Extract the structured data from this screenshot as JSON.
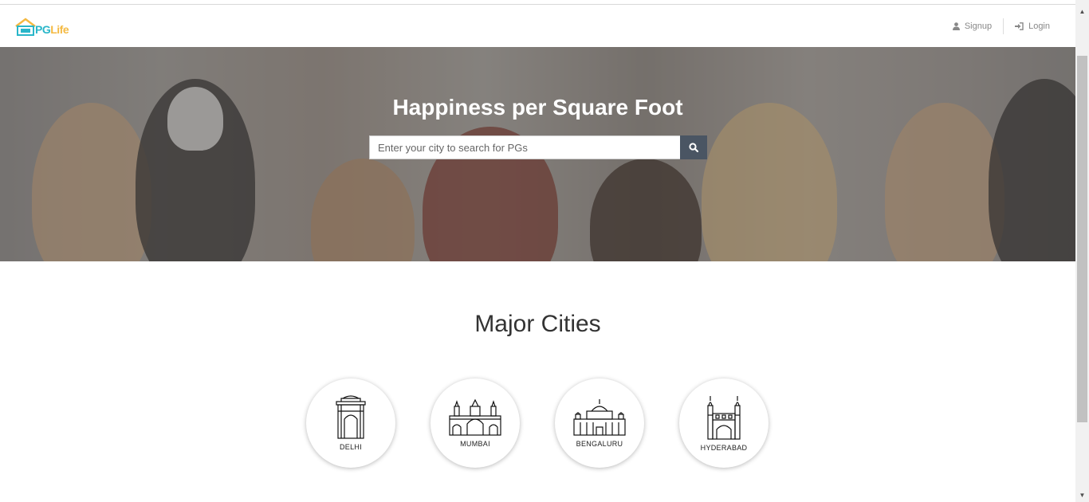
{
  "brand": {
    "pg": "PG",
    "life": "Life"
  },
  "nav": {
    "signup_label": "Signup",
    "login_label": "Login"
  },
  "hero": {
    "title": "Happiness per Square Foot",
    "search_placeholder": "Enter your city to search for PGs"
  },
  "section": {
    "title": "Major Cities"
  },
  "cities": [
    {
      "label": "DELHI",
      "icon": "india-gate-icon"
    },
    {
      "label": "MUMBAI",
      "icon": "gateway-of-india-icon"
    },
    {
      "label": "BENGALURU",
      "icon": "vidhana-soudha-icon"
    },
    {
      "label": "HYDERABAD",
      "icon": "charminar-icon"
    }
  ],
  "colors": {
    "accent_teal": "#29b6c9",
    "accent_yellow": "#f4b942",
    "search_button": "#4a5563"
  }
}
